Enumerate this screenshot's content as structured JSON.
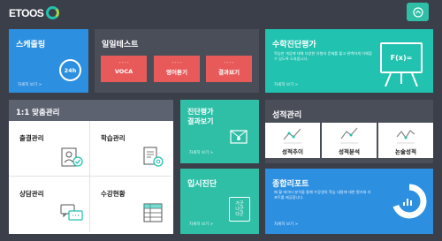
{
  "brand": {
    "logo_text": "ETOOS"
  },
  "schedule": {
    "title": "스케줄링",
    "icon_text": "24h",
    "more": "자세히 보기 >"
  },
  "daily_test": {
    "title": "일일테스트",
    "buttons": [
      "VOCA",
      "영어듣기",
      "결과보기"
    ]
  },
  "math": {
    "title": "수학진단평가",
    "desc": "학습한 개념에 대해 다양한 유형의 문제를 풀고 완벽하게 이해할 수 있도록 도와줍니다.",
    "icon_text": "F(x)=",
    "more": "자세히 보기 >"
  },
  "oneone": {
    "title": "1:1 맞춤관리",
    "cells": [
      "출결관리",
      "학습관리",
      "상담관리",
      "수강현황"
    ]
  },
  "diagnostic": {
    "title_line1": "진단평가",
    "title_line2": "결과보기",
    "more": "자세히 보기 >"
  },
  "grades": {
    "title": "성적관리",
    "items": [
      "성적추이",
      "성적분석",
      "논술성적"
    ]
  },
  "entrance": {
    "title": "입시진단",
    "icon_text": "가군\n나군\n다군",
    "more": "자세히 보기 >"
  },
  "report": {
    "title": "종합리포트",
    "desc": "매 월 데이터 분석을 통해 수강생의 학습 내용에 대한 평가와 리포트를 제공합니다.",
    "more": "자세히 보기 >"
  },
  "colors": {
    "blue": "#2d8fe0",
    "teal": "#21c2b0",
    "red": "#e85a5a",
    "dark": "#3b3f4a"
  }
}
